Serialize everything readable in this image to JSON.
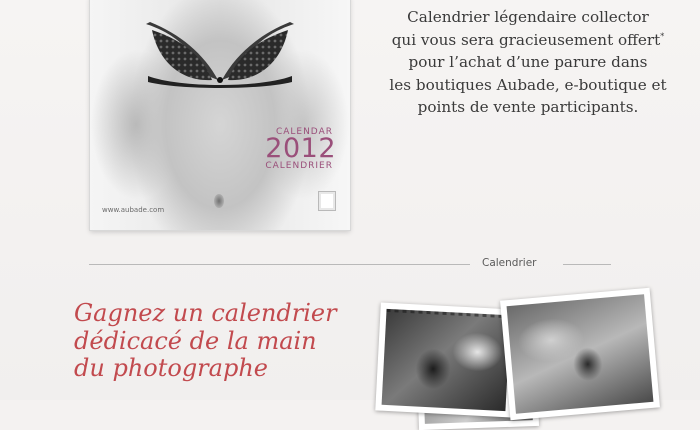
{
  "calendar": {
    "label_top": "CALENDAR",
    "year": "2012",
    "label_bottom": "CALENDRIER",
    "site": "www.aubade.com"
  },
  "promo": {
    "lines": [
      "Calendrier légendaire collector",
      "qui vous sera gracieusement offert",
      "pour l’achat d’une parure dans",
      "les boutiques Aubade, e-boutique et",
      "points de vente participants."
    ],
    "footnote_mark": "*"
  },
  "divider": {
    "label": "Calendrier"
  },
  "contest": {
    "lines": [
      "Gagnez un calendrier",
      "dédicacé de la main",
      "du photographe"
    ]
  },
  "colors": {
    "accent": "#c24a4e",
    "calendar_accent": "#9a4f7a",
    "body_text": "#3a3a3a"
  }
}
